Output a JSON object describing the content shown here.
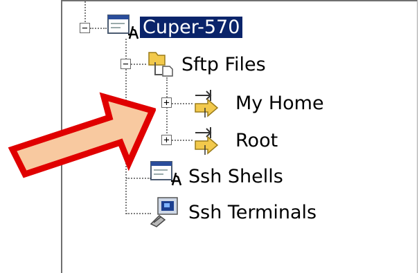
{
  "tree": {
    "root": {
      "label": "Cuper-570",
      "expander": "−",
      "selected": true
    },
    "sftp": {
      "label": "Sftp Files",
      "expander": "−"
    },
    "my_home": {
      "label": "My Home",
      "expander": "+"
    },
    "root_dir": {
      "label": "Root",
      "expander": "+"
    },
    "ssh_shells": {
      "label": "Ssh Shells"
    },
    "ssh_terminals": {
      "label": "Ssh Terminals"
    }
  },
  "colors": {
    "selection": "#0a246a",
    "arrow_fill": "#f8c9a0",
    "arrow_stroke": "#e00000",
    "folder": "#f2c94c"
  },
  "icons": [
    "computer-icon",
    "folder-file-icon",
    "mapped-folder-arrow-icon",
    "terminal-icon"
  ]
}
